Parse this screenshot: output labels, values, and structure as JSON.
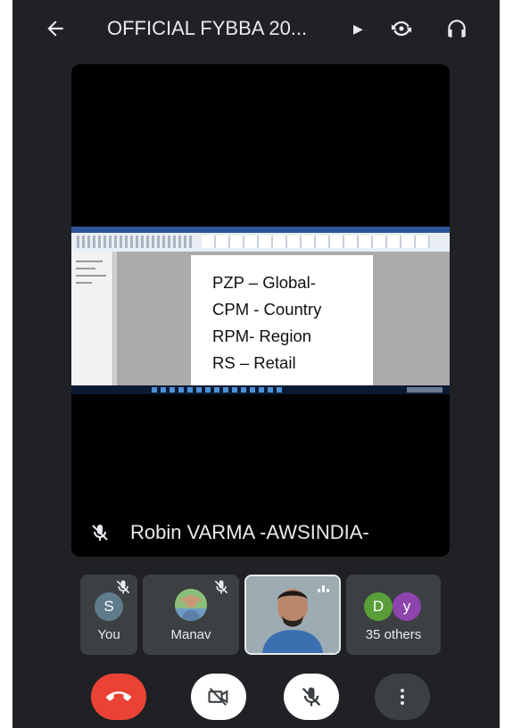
{
  "header": {
    "title": "OFFICIAL FYBBA 20...",
    "icons": [
      "back-arrow-icon",
      "dropdown-arrow-icon",
      "switch-camera-icon",
      "headphones-icon"
    ]
  },
  "main_tile": {
    "presenter_name": "Robin VARMA -AWSINDIA-",
    "presenter_muted": true,
    "shared_document_lines": [
      "PZP – Global-",
      "CPM - Country",
      "RPM- Region",
      "RS – Retail"
    ]
  },
  "participants": [
    {
      "label": "You",
      "avatar_letter": "S",
      "avatar_color": "#5f7b8c",
      "muted": true
    },
    {
      "label": "Manav",
      "avatar_kind": "photo",
      "muted": true
    },
    {
      "label": "",
      "avatar_kind": "video",
      "speaking": true
    },
    {
      "label": "35 others",
      "avatar_letters": [
        "D",
        "y"
      ],
      "avatar_colors": [
        "#5a9e3a",
        "#8e44ad"
      ]
    }
  ],
  "controls": [
    {
      "name": "end-call",
      "icon": "phone-hangup-icon",
      "color": "#ea4335"
    },
    {
      "name": "camera-off",
      "icon": "camera-off-icon",
      "color": "#ffffff"
    },
    {
      "name": "mic-off",
      "icon": "mic-off-icon",
      "color": "#ffffff"
    },
    {
      "name": "more-options",
      "icon": "more-vertical-icon",
      "color": "#3c4043"
    }
  ]
}
